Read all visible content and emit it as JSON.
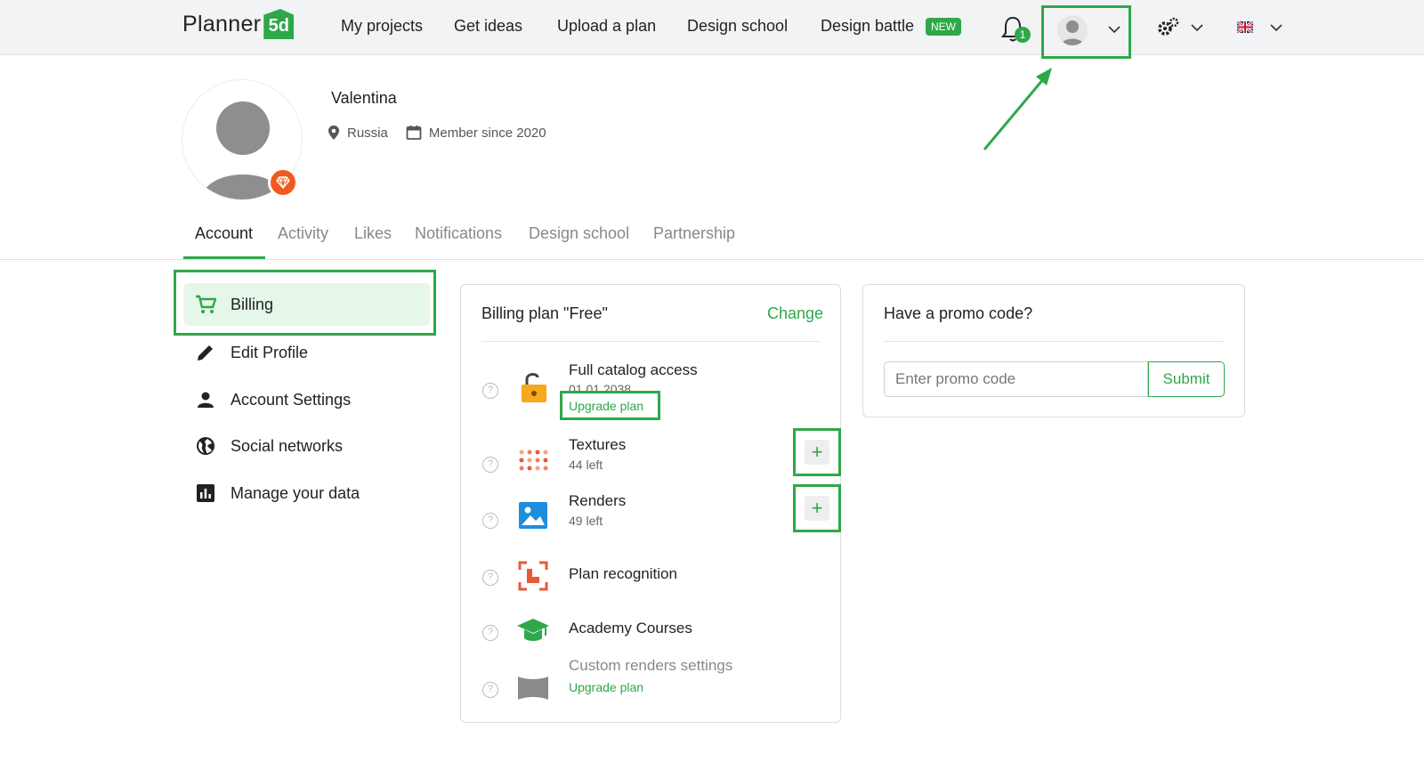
{
  "header": {
    "logo_text": "Planner",
    "logo_badge": "5d",
    "nav": [
      "My projects",
      "Get ideas",
      "Upload a plan",
      "Design school",
      "Design battle"
    ],
    "new_badge": "NEW",
    "notification_count": "1"
  },
  "profile": {
    "name": "Valentina",
    "country": "Russia",
    "member_since": "Member since 2020"
  },
  "tabs": [
    "Account",
    "Activity",
    "Likes",
    "Notifications",
    "Design school",
    "Partnership"
  ],
  "sidebar": {
    "items": [
      {
        "label": "Billing",
        "icon": "cart-icon"
      },
      {
        "label": "Edit Profile",
        "icon": "pencil-icon"
      },
      {
        "label": "Account Settings",
        "icon": "person-icon"
      },
      {
        "label": "Social networks",
        "icon": "globe-icon"
      },
      {
        "label": "Manage your data",
        "icon": "chart-icon"
      }
    ]
  },
  "billing": {
    "title": "Billing plan \"Free\"",
    "change": "Change",
    "features": [
      {
        "name": "Full catalog access",
        "sub": "01.01.2038",
        "link": "Upgrade plan"
      },
      {
        "name": "Textures",
        "sub": "44 left"
      },
      {
        "name": "Renders",
        "sub": "49 left"
      },
      {
        "name": "Plan recognition"
      },
      {
        "name": "Academy Courses"
      },
      {
        "name": "Custom renders settings",
        "link": "Upgrade plan"
      }
    ],
    "plus": "+"
  },
  "promo": {
    "title": "Have a promo code?",
    "placeholder": "Enter promo code",
    "submit": "Submit"
  },
  "colors": {
    "accent": "#2ea84a",
    "badge_orange": "#f05a1e"
  }
}
